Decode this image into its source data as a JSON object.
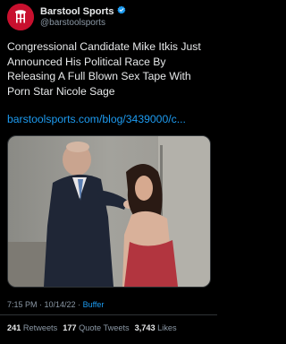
{
  "account": {
    "display_name": "Barstool Sports",
    "handle": "@barstoolsports",
    "verified": true,
    "avatar_icon": "barstool-logo-icon",
    "avatar_color": "#c8102e"
  },
  "tweet": {
    "text": "Congressional Candidate Mike Itkis Just Announced His Political Race By Releasing A Full Blown Sex Tape With Porn Star Nicole Sage",
    "link": "barstoolsports.com/blog/3439000/c..."
  },
  "meta": {
    "time": "7:15 PM",
    "separator": " · ",
    "date": "10/14/22",
    "source": "Buffer"
  },
  "stats": {
    "retweets_count": "241",
    "retweets_label": " Retweets",
    "quote_count": "177",
    "quote_label": " Quote Tweets",
    "likes_count": "3,743",
    "likes_label": " Likes"
  },
  "colors": {
    "background": "#000000",
    "link": "#1d9bf0",
    "muted": "#8b98a5",
    "verified": "#1d9bf0"
  }
}
